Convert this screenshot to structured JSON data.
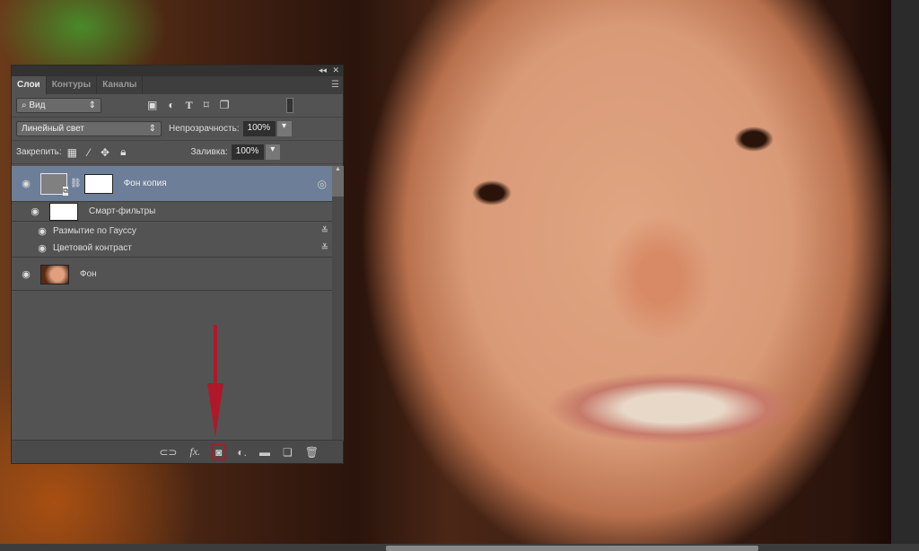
{
  "panel": {
    "tabs": [
      "Слои",
      "Контуры",
      "Каналы"
    ],
    "filter_select": "Вид",
    "blend_mode": "Линейный свет",
    "opacity_label": "Непрозрачность:",
    "opacity_value": "100%",
    "lock_label": "Закрепить:",
    "fill_label": "Заливка:",
    "fill_value": "100%",
    "layers": [
      {
        "name": "Фон копия",
        "selected": true
      },
      {
        "name": "Смарт-фильтры"
      },
      {
        "name": "Размытие по Гауссу"
      },
      {
        "name": "Цветовой контраст"
      },
      {
        "name": "Фон"
      }
    ]
  },
  "colors": {
    "highlight": "#b0182a",
    "selected_layer": "#6d7f98"
  }
}
